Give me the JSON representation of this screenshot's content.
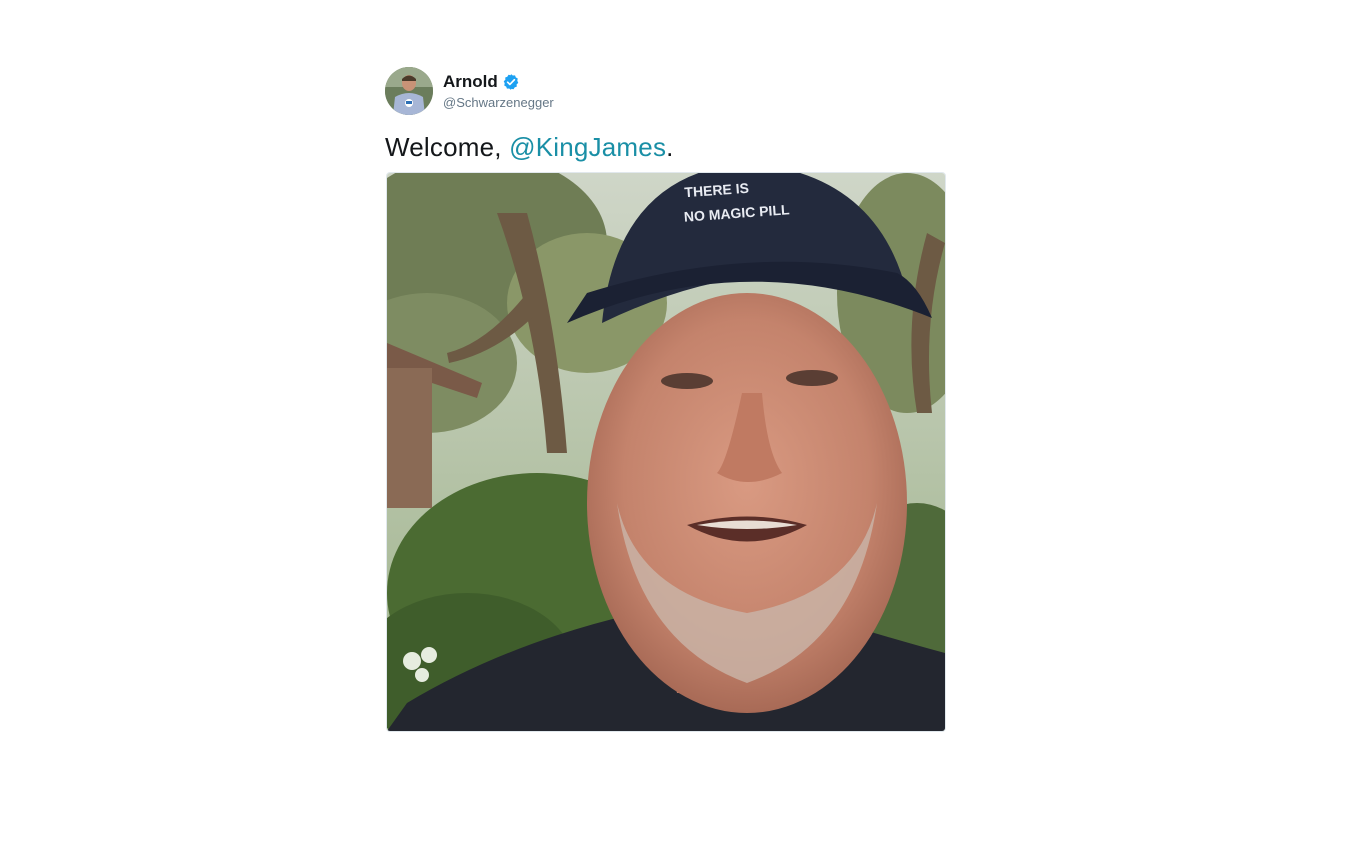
{
  "tweet": {
    "display_name": "Arnold",
    "handle": "@Schwarzenegger",
    "text_prefix": "Welcome, ",
    "mention": "@KingJames",
    "text_suffix": ".",
    "verified_icon": "verified-badge-icon",
    "colors": {
      "verified": "#1da1f2",
      "mention": "#1a8fa6",
      "name": "#14171a",
      "handle": "#657786"
    }
  },
  "media": {
    "cap_text_line1": "THERE IS",
    "cap_text_line2": "NO MAGIC PILL"
  }
}
